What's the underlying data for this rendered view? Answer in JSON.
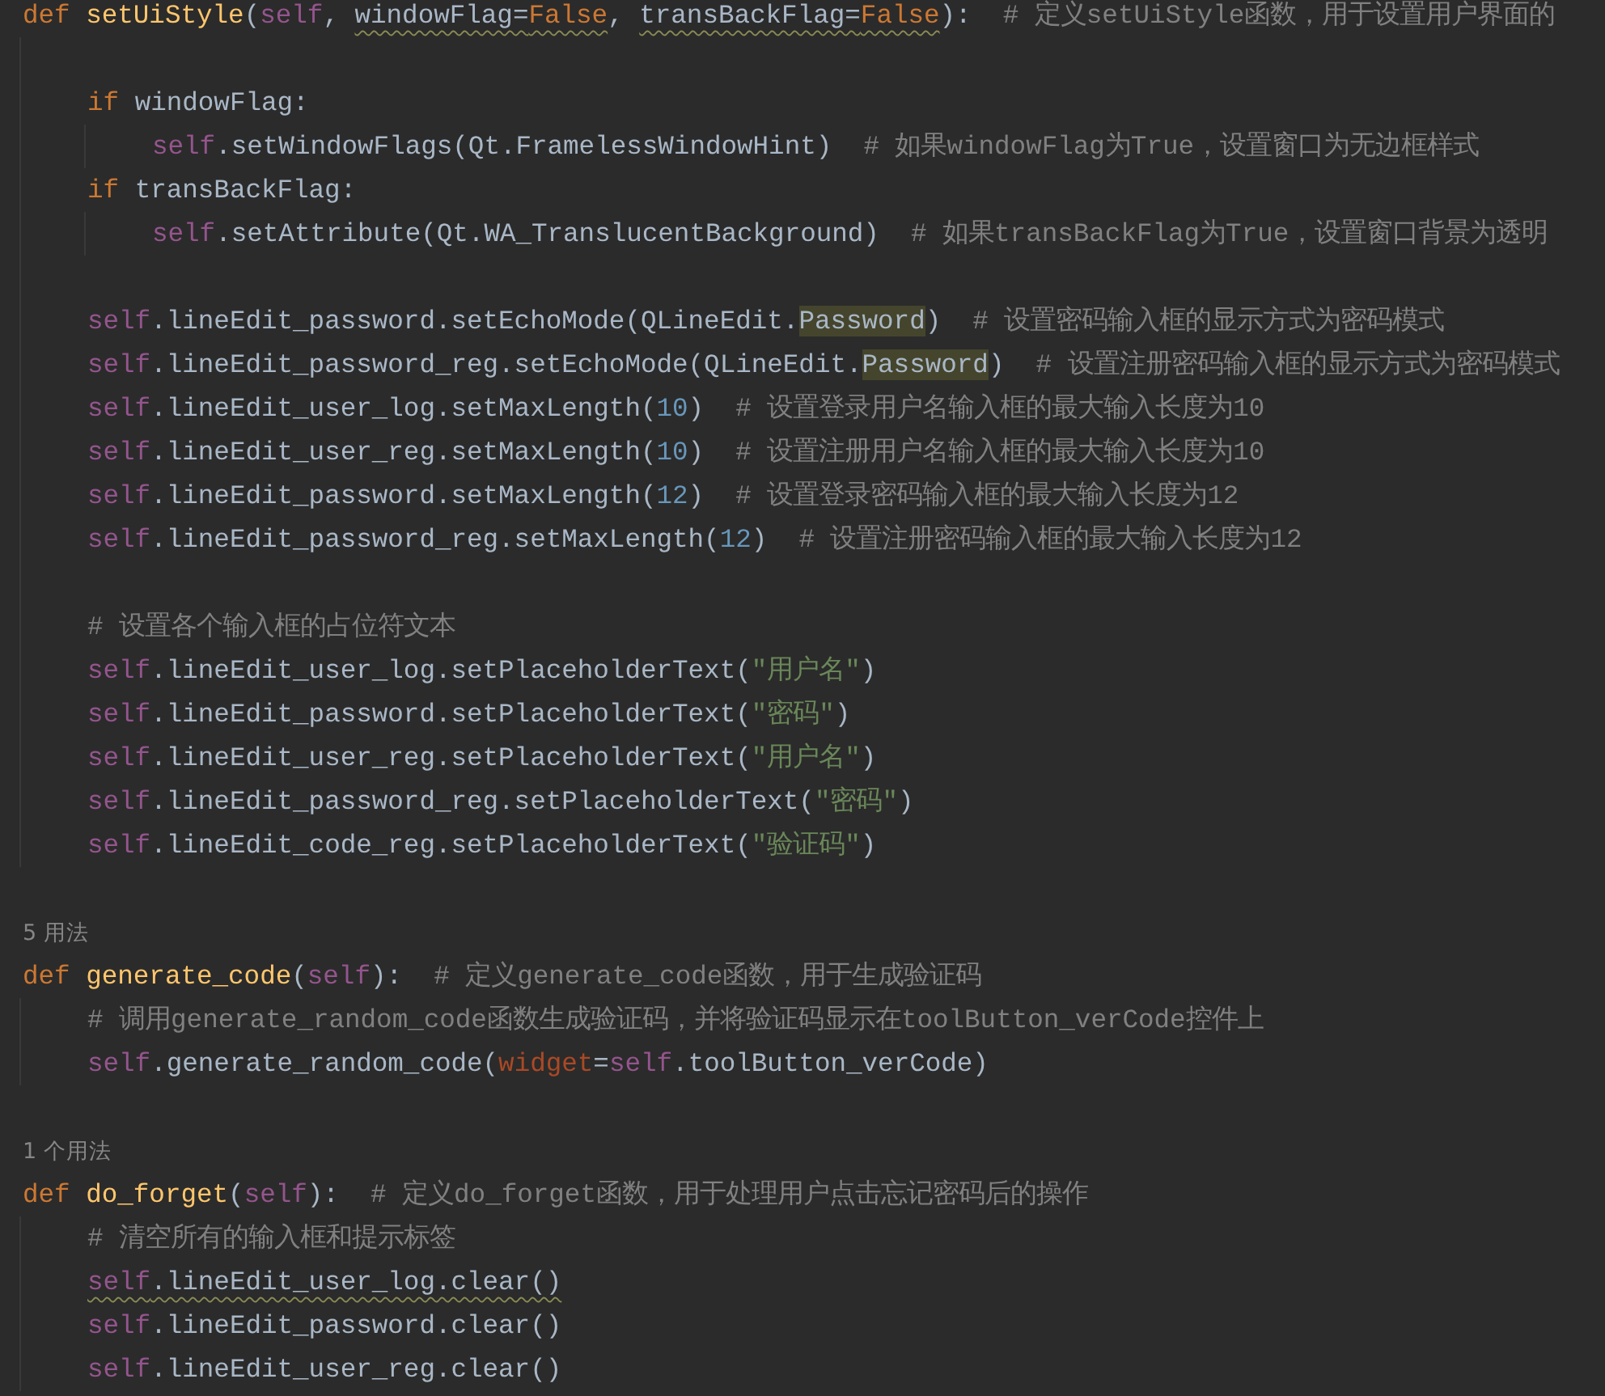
{
  "editor": {
    "lines": [
      {
        "kind": "code",
        "tokens": [
          {
            "kind": "keyword",
            "text": "def "
          },
          {
            "kind": "function",
            "text": "setUiStyle"
          },
          {
            "kind": "plain",
            "text": "("
          },
          {
            "kind": "self",
            "text": "self"
          },
          {
            "kind": "plain",
            "text": ", "
          },
          {
            "kind": "plain-warned",
            "text": "windowFlag="
          },
          {
            "kind": "constant-warned",
            "text": "False"
          },
          {
            "kind": "plain",
            "text": ", "
          },
          {
            "kind": "plain-warned",
            "text": "transBackFlag="
          },
          {
            "kind": "constant-warned",
            "text": "False"
          },
          {
            "kind": "plain",
            "text": "):  "
          },
          {
            "kind": "comment",
            "text": "# 定义setUiStyle函数，用于设置用户界面的"
          }
        ],
        "children": [
          {
            "kind": "blank"
          },
          {
            "kind": "code",
            "tokens": [
              {
                "kind": "keyword",
                "text": "if"
              },
              {
                "kind": "plain",
                "text": " windowFlag:"
              }
            ],
            "children": [
              {
                "kind": "code",
                "tokens": [
                  {
                    "kind": "self",
                    "text": "self"
                  },
                  {
                    "kind": "plain",
                    "text": ".setWindowFlags(Qt.FramelessWindowHint)  "
                  },
                  {
                    "kind": "comment",
                    "text": "# 如果windowFlag为True，设置窗口为无边框样式"
                  }
                ]
              }
            ]
          },
          {
            "kind": "code",
            "tokens": [
              {
                "kind": "keyword",
                "text": "if"
              },
              {
                "kind": "plain",
                "text": " transBackFlag:"
              }
            ],
            "children": [
              {
                "kind": "code",
                "tokens": [
                  {
                    "kind": "self",
                    "text": "self"
                  },
                  {
                    "kind": "plain",
                    "text": ".setAttribute(Qt.WA_TranslucentBackground)  "
                  },
                  {
                    "kind": "comment",
                    "text": "# 如果transBackFlag为True，设置窗口背景为透明"
                  }
                ]
              }
            ]
          },
          {
            "kind": "blank"
          },
          {
            "kind": "code",
            "tokens": [
              {
                "kind": "self",
                "text": "self"
              },
              {
                "kind": "plain",
                "text": ".lineEdit_password.setEchoMode(QLineEdit."
              },
              {
                "kind": "highlighted",
                "text": "Password"
              },
              {
                "kind": "plain",
                "text": ")  "
              },
              {
                "kind": "comment",
                "text": "# 设置密码输入框的显示方式为密码模式"
              }
            ]
          },
          {
            "kind": "code",
            "tokens": [
              {
                "kind": "self",
                "text": "self"
              },
              {
                "kind": "plain",
                "text": ".lineEdit_password_reg.setEchoMode(QLineEdit."
              },
              {
                "kind": "highlighted",
                "text": "Password"
              },
              {
                "kind": "plain",
                "text": ")  "
              },
              {
                "kind": "comment",
                "text": "# 设置注册密码输入框的显示方式为密码模式"
              }
            ]
          },
          {
            "kind": "code",
            "tokens": [
              {
                "kind": "self",
                "text": "self"
              },
              {
                "kind": "plain",
                "text": ".lineEdit_user_log.setMaxLength("
              },
              {
                "kind": "number",
                "text": "10"
              },
              {
                "kind": "plain",
                "text": ")  "
              },
              {
                "kind": "comment",
                "text": "# 设置登录用户名输入框的最大输入长度为10"
              }
            ]
          },
          {
            "kind": "code",
            "tokens": [
              {
                "kind": "self",
                "text": "self"
              },
              {
                "kind": "plain",
                "text": ".lineEdit_user_reg.setMaxLength("
              },
              {
                "kind": "number",
                "text": "10"
              },
              {
                "kind": "plain",
                "text": ")  "
              },
              {
                "kind": "comment",
                "text": "# 设置注册用户名输入框的最大输入长度为10"
              }
            ]
          },
          {
            "kind": "code",
            "tokens": [
              {
                "kind": "self",
                "text": "self"
              },
              {
                "kind": "plain",
                "text": ".lineEdit_password.setMaxLength("
              },
              {
                "kind": "number",
                "text": "12"
              },
              {
                "kind": "plain",
                "text": ")  "
              },
              {
                "kind": "comment",
                "text": "# 设置登录密码输入框的最大输入长度为12"
              }
            ]
          },
          {
            "kind": "code",
            "tokens": [
              {
                "kind": "self",
                "text": "self"
              },
              {
                "kind": "plain",
                "text": ".lineEdit_password_reg.setMaxLength("
              },
              {
                "kind": "number",
                "text": "12"
              },
              {
                "kind": "plain",
                "text": ")  "
              },
              {
                "kind": "comment",
                "text": "# 设置注册密码输入框的最大输入长度为12"
              }
            ]
          },
          {
            "kind": "blank"
          },
          {
            "kind": "code",
            "tokens": [
              {
                "kind": "comment",
                "text": "# 设置各个输入框的占位符文本"
              }
            ]
          },
          {
            "kind": "code",
            "tokens": [
              {
                "kind": "self",
                "text": "self"
              },
              {
                "kind": "plain",
                "text": ".lineEdit_user_log.setPlaceholderText("
              },
              {
                "kind": "string",
                "text": "\"用户名\""
              },
              {
                "kind": "plain",
                "text": ")"
              }
            ]
          },
          {
            "kind": "code",
            "tokens": [
              {
                "kind": "self",
                "text": "self"
              },
              {
                "kind": "plain",
                "text": ".lineEdit_password.setPlaceholderText("
              },
              {
                "kind": "string",
                "text": "\"密码\""
              },
              {
                "kind": "plain",
                "text": ")"
              }
            ]
          },
          {
            "kind": "code",
            "tokens": [
              {
                "kind": "self",
                "text": "self"
              },
              {
                "kind": "plain",
                "text": ".lineEdit_user_reg.setPlaceholderText("
              },
              {
                "kind": "string",
                "text": "\"用户名\""
              },
              {
                "kind": "plain",
                "text": ")"
              }
            ]
          },
          {
            "kind": "code",
            "tokens": [
              {
                "kind": "self",
                "text": "self"
              },
              {
                "kind": "plain",
                "text": ".lineEdit_password_reg.setPlaceholderText("
              },
              {
                "kind": "string",
                "text": "\"密码\""
              },
              {
                "kind": "plain",
                "text": ")"
              }
            ]
          },
          {
            "kind": "code",
            "tokens": [
              {
                "kind": "self",
                "text": "self"
              },
              {
                "kind": "plain",
                "text": ".lineEdit_code_reg.setPlaceholderText("
              },
              {
                "kind": "string",
                "text": "\"验证码\""
              },
              {
                "kind": "plain",
                "text": ")"
              }
            ]
          }
        ]
      },
      {
        "kind": "blank"
      },
      {
        "kind": "hint",
        "text": "5 用法"
      },
      {
        "kind": "code",
        "tokens": [
          {
            "kind": "keyword",
            "text": "def "
          },
          {
            "kind": "function",
            "text": "generate_code"
          },
          {
            "kind": "plain",
            "text": "("
          },
          {
            "kind": "self",
            "text": "self"
          },
          {
            "kind": "plain",
            "text": "):  "
          },
          {
            "kind": "comment",
            "text": "# 定义generate_code函数，用于生成验证码"
          }
        ],
        "children": [
          {
            "kind": "code",
            "tokens": [
              {
                "kind": "comment",
                "text": "# 调用generate_random_code函数生成验证码，并将验证码显示在toolButton_verCode控件上"
              }
            ]
          },
          {
            "kind": "code",
            "tokens": [
              {
                "kind": "self",
                "text": "self"
              },
              {
                "kind": "plain",
                "text": ".generate_random_code("
              },
              {
                "kind": "named-arg",
                "text": "widget"
              },
              {
                "kind": "plain",
                "text": "="
              },
              {
                "kind": "self",
                "text": "self"
              },
              {
                "kind": "plain",
                "text": ".toolButton_verCode)"
              }
            ]
          }
        ]
      },
      {
        "kind": "blank"
      },
      {
        "kind": "hint",
        "text": "1 个用法"
      },
      {
        "kind": "code",
        "tokens": [
          {
            "kind": "keyword",
            "text": "def "
          },
          {
            "kind": "function",
            "text": "do_forget"
          },
          {
            "kind": "plain",
            "text": "("
          },
          {
            "kind": "self",
            "text": "self"
          },
          {
            "kind": "plain",
            "text": "):  "
          },
          {
            "kind": "comment",
            "text": "# 定义do_forget函数，用于处理用户点击忘记密码后的操作"
          }
        ],
        "children": [
          {
            "kind": "code",
            "tokens": [
              {
                "kind": "comment",
                "text": "# 清空所有的输入框和提示标签"
              }
            ]
          },
          {
            "kind": "code",
            "tokens": [
              {
                "kind": "self-warned",
                "text": "self"
              },
              {
                "kind": "plain-warned",
                "text": ".lineEdit_user_log.clear()"
              }
            ]
          },
          {
            "kind": "code",
            "tokens": [
              {
                "kind": "self",
                "text": "self"
              },
              {
                "kind": "plain",
                "text": ".lineEdit_password.clear()"
              }
            ]
          },
          {
            "kind": "code",
            "tokens": [
              {
                "kind": "self",
                "text": "self"
              },
              {
                "kind": "plain",
                "text": ".lineEdit_user_reg.clear()"
              }
            ]
          }
        ]
      }
    ]
  }
}
